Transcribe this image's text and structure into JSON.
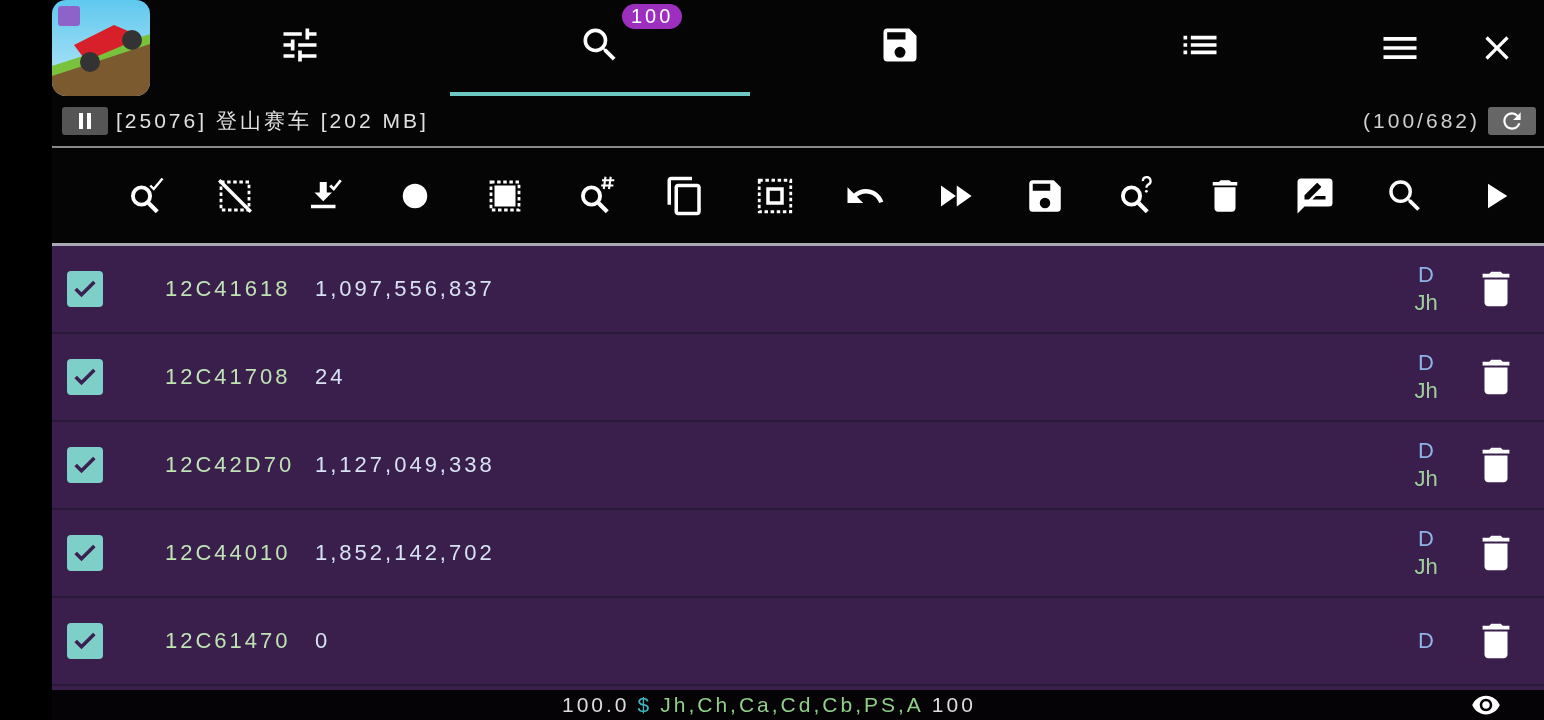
{
  "top_bar": {
    "tabs": [
      {
        "kind": "sliders",
        "selected": false
      },
      {
        "kind": "search",
        "selected": true,
        "badge": "100"
      },
      {
        "kind": "save",
        "selected": false
      },
      {
        "kind": "list",
        "selected": false
      }
    ],
    "process": "[25076] 登山赛车 [202 MB]",
    "count": "(100/682)"
  },
  "toolbar": [
    {
      "kind": "search-check"
    },
    {
      "kind": "select-off"
    },
    {
      "kind": "download-check"
    },
    {
      "kind": "circle"
    },
    {
      "kind": "select-all"
    },
    {
      "kind": "search-hash"
    },
    {
      "kind": "copy"
    },
    {
      "kind": "select-inverse"
    },
    {
      "kind": "undo"
    },
    {
      "kind": "fast-forward"
    },
    {
      "kind": "save"
    },
    {
      "kind": "search-question"
    },
    {
      "kind": "delete"
    },
    {
      "kind": "edit-comment"
    },
    {
      "kind": "search"
    },
    {
      "kind": "play"
    }
  ],
  "results": [
    {
      "checked": true,
      "address": "12C41618",
      "value": "1,097,556,837",
      "type": "D",
      "regions": "Jh"
    },
    {
      "checked": true,
      "address": "12C41708",
      "value": "24",
      "type": "D",
      "regions": "Jh"
    },
    {
      "checked": true,
      "address": "12C42D70",
      "value": "1,127,049,338",
      "type": "D",
      "regions": "Jh"
    },
    {
      "checked": true,
      "address": "12C44010",
      "value": "1,852,142,702",
      "type": "D",
      "regions": "Jh"
    },
    {
      "checked": true,
      "address": "12C61470",
      "value": "0",
      "type": "D"
    }
  ],
  "status_bar": {
    "value": "100.0",
    "symbol": "$",
    "regions": "Jh,Ch,Ca,Cd,Cb,PS,A",
    "count": "100"
  }
}
